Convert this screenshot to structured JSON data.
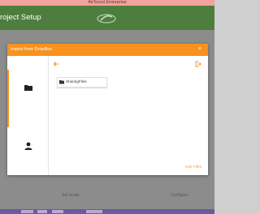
{
  "window": {
    "title": "AirScout Enterprise"
  },
  "app": {
    "page_title": "roject Setup",
    "logo_icon": "airscout-logo-icon"
  },
  "background": {
    "buttons": [
      "Set Scale",
      "Configure"
    ]
  },
  "dialog": {
    "title": "Import from DropBox",
    "close_label": "×",
    "sidebar": [
      {
        "icon": "folder-icon",
        "selected": true
      },
      {
        "icon": "account-icon",
        "selected": false
      }
    ],
    "folders": [
      {
        "name": "SharingFiles"
      }
    ],
    "use_files_label": "Use Files"
  },
  "colors": {
    "accent": "#f7921e",
    "app_header": "#4e7e3e",
    "titlebar": "#f2a39b"
  }
}
